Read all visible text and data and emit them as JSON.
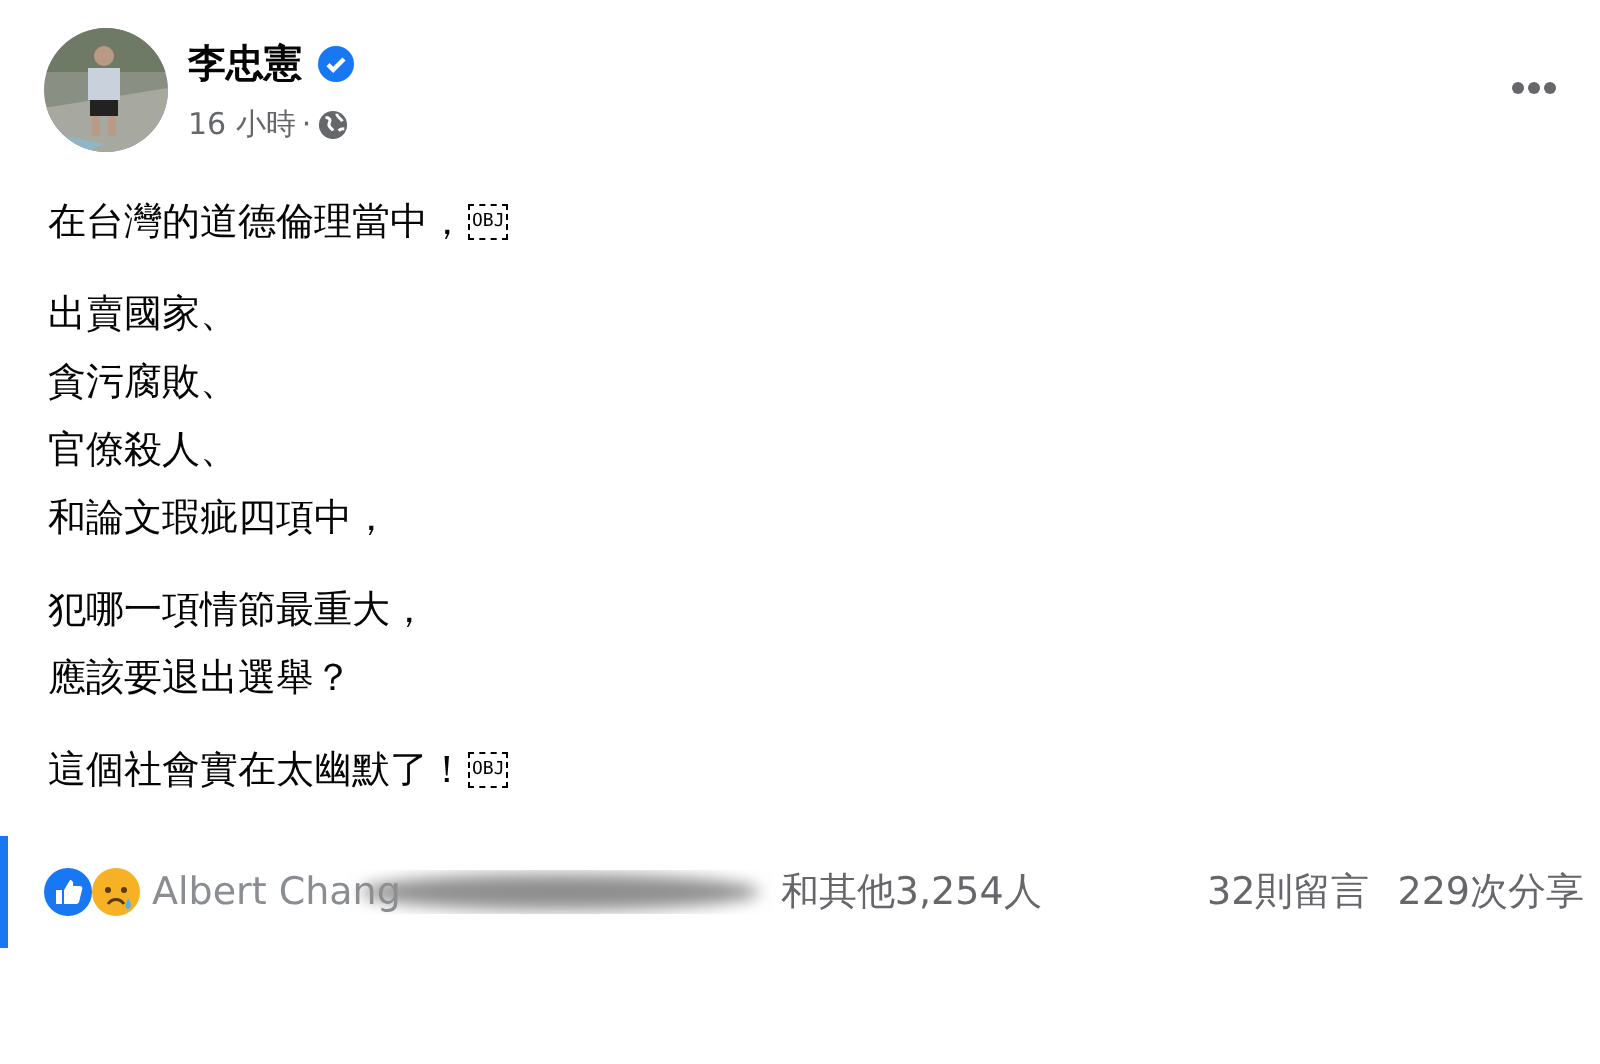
{
  "post": {
    "author": "李忠憲",
    "verified": true,
    "time": "16 小時",
    "separator": "·",
    "paragraphs": [
      {
        "lines": [
          "在台灣的道德倫理當中，"
        ],
        "end_mark": "OBJ"
      },
      {
        "lines": [
          "出賣國家、",
          "貪污腐敗、",
          "官僚殺人、",
          "和論文瑕疵四項中，"
        ]
      },
      {
        "lines": [
          "犯哪一項情節最重大，",
          "應該要退出選舉？"
        ]
      },
      {
        "lines": [
          "這個社會實在太幽默了！"
        ],
        "end_mark": "OBJ"
      }
    ],
    "reactions": {
      "names": "Albert Chang",
      "others": "和其他3,254人"
    },
    "comments": "32則留言",
    "shares": "229次分享"
  }
}
